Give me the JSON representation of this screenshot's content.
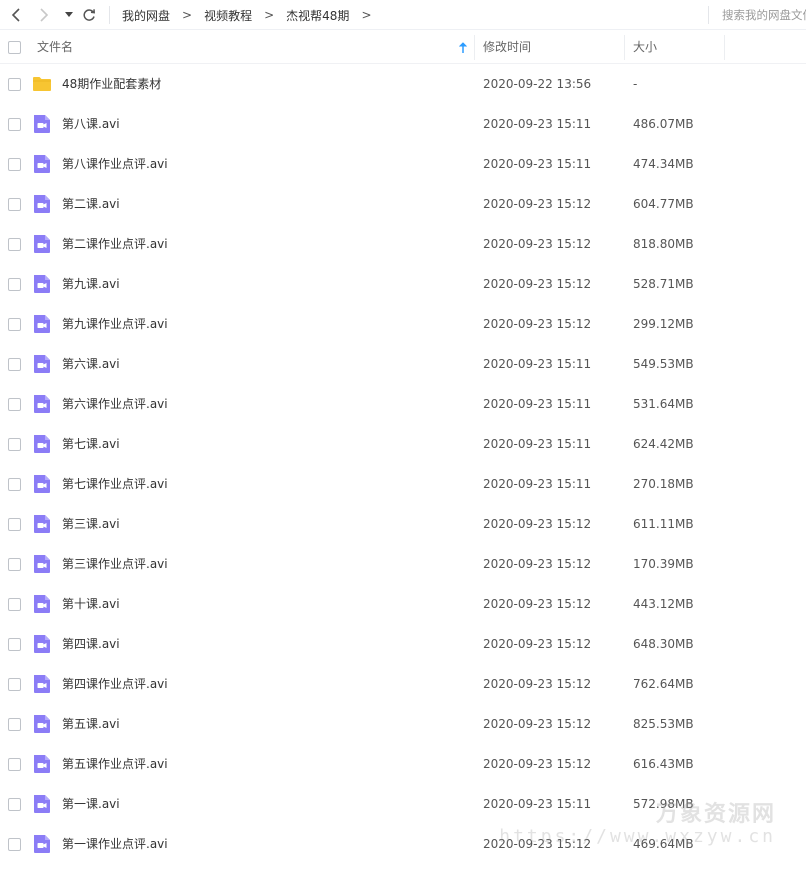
{
  "breadcrumb": [
    "我的网盘",
    "视频教程",
    "杰视帮48期"
  ],
  "breadcrumb_separator": ">",
  "search": {
    "placeholder": "搜索我的网盘文件"
  },
  "columns": {
    "name": "文件名",
    "time": "修改时间",
    "size": "大小"
  },
  "colors": {
    "folder": "#f7c532",
    "video": "#8b7cf6",
    "sort_arrow": "#2d9cff"
  },
  "files": [
    {
      "type": "folder",
      "name": "48期作业配套素材",
      "time": "2020-09-22 13:56",
      "size": "-"
    },
    {
      "type": "video",
      "name": "第八课.avi",
      "time": "2020-09-23 15:11",
      "size": "486.07MB"
    },
    {
      "type": "video",
      "name": "第八课作业点评.avi",
      "time": "2020-09-23 15:11",
      "size": "474.34MB"
    },
    {
      "type": "video",
      "name": "第二课.avi",
      "time": "2020-09-23 15:12",
      "size": "604.77MB"
    },
    {
      "type": "video",
      "name": "第二课作业点评.avi",
      "time": "2020-09-23 15:12",
      "size": "818.80MB"
    },
    {
      "type": "video",
      "name": "第九课.avi",
      "time": "2020-09-23 15:12",
      "size": "528.71MB"
    },
    {
      "type": "video",
      "name": "第九课作业点评.avi",
      "time": "2020-09-23 15:12",
      "size": "299.12MB"
    },
    {
      "type": "video",
      "name": "第六课.avi",
      "time": "2020-09-23 15:11",
      "size": "549.53MB"
    },
    {
      "type": "video",
      "name": "第六课作业点评.avi",
      "time": "2020-09-23 15:11",
      "size": "531.64MB"
    },
    {
      "type": "video",
      "name": "第七课.avi",
      "time": "2020-09-23 15:11",
      "size": "624.42MB"
    },
    {
      "type": "video",
      "name": "第七课作业点评.avi",
      "time": "2020-09-23 15:11",
      "size": "270.18MB"
    },
    {
      "type": "video",
      "name": "第三课.avi",
      "time": "2020-09-23 15:12",
      "size": "611.11MB"
    },
    {
      "type": "video",
      "name": "第三课作业点评.avi",
      "time": "2020-09-23 15:12",
      "size": "170.39MB"
    },
    {
      "type": "video",
      "name": "第十课.avi",
      "time": "2020-09-23 15:12",
      "size": "443.12MB"
    },
    {
      "type": "video",
      "name": "第四课.avi",
      "time": "2020-09-23 15:12",
      "size": "648.30MB"
    },
    {
      "type": "video",
      "name": "第四课作业点评.avi",
      "time": "2020-09-23 15:12",
      "size": "762.64MB"
    },
    {
      "type": "video",
      "name": "第五课.avi",
      "time": "2020-09-23 15:12",
      "size": "825.53MB"
    },
    {
      "type": "video",
      "name": "第五课作业点评.avi",
      "time": "2020-09-23 15:12",
      "size": "616.43MB"
    },
    {
      "type": "video",
      "name": "第一课.avi",
      "time": "2020-09-23 15:11",
      "size": "572.98MB"
    },
    {
      "type": "video",
      "name": "第一课作业点评.avi",
      "time": "2020-09-23 15:12",
      "size": "469.64MB"
    }
  ],
  "watermark": {
    "title": "万象资源网",
    "url": "https://www.wxzyw.cn"
  }
}
